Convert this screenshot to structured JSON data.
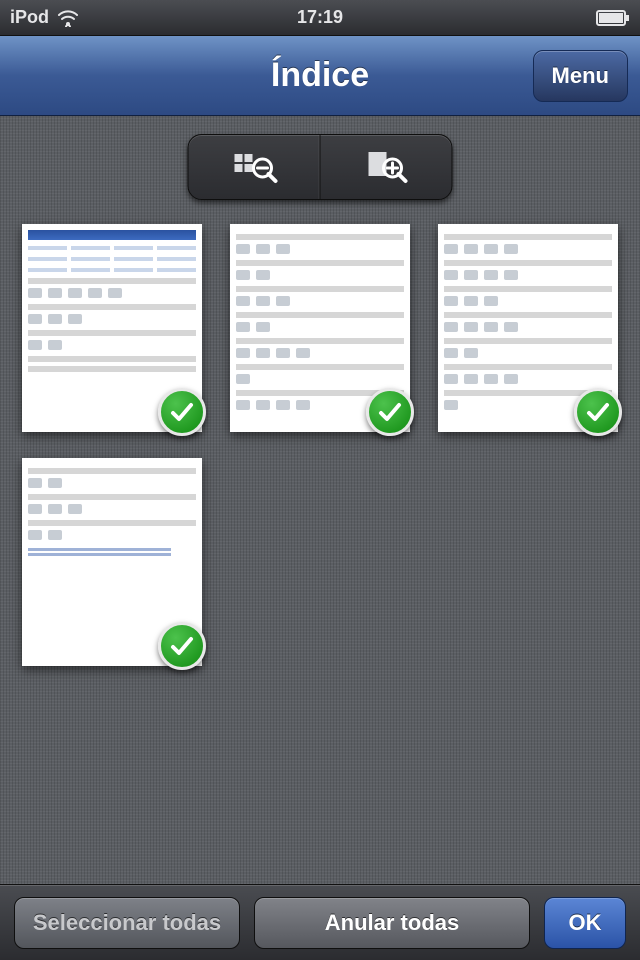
{
  "status": {
    "device_label": "iPod",
    "time": "17:19",
    "wifi_icon": "wifi-icon",
    "battery_icon": "battery-icon"
  },
  "nav": {
    "title": "Índice",
    "menu_label": "Menu"
  },
  "zoom_toolbar": {
    "zoom_out_icon": "zoom-out-icon",
    "zoom_in_icon": "zoom-in-icon"
  },
  "thumbnails": [
    {
      "index": 1,
      "selected": true
    },
    {
      "index": 2,
      "selected": true
    },
    {
      "index": 3,
      "selected": true
    },
    {
      "index": 4,
      "selected": true
    }
  ],
  "bottom": {
    "select_all_label": "Seleccionar todas",
    "deselect_all_label": "Anular todas",
    "ok_label": "OK"
  },
  "colors": {
    "nav_blue_top": "#6f93c6",
    "nav_blue_bottom": "#2d4a83",
    "linen_bg": "#5b5e63",
    "ok_blue": "#2b53a7",
    "check_green": "#108a10"
  }
}
